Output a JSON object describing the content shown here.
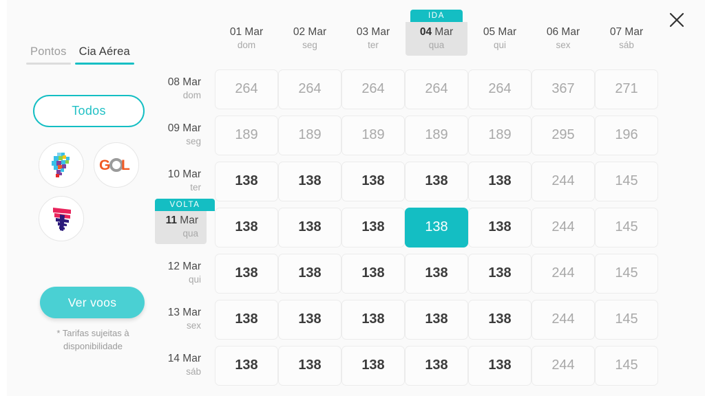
{
  "close_icon": "close-icon",
  "sidebar": {
    "tabs": [
      {
        "label": "Pontos",
        "active": false
      },
      {
        "label": "Cia Aérea",
        "active": true
      }
    ],
    "filter_button": "Todos",
    "airlines": [
      {
        "name": "azul-logo"
      },
      {
        "name": "gol-logo"
      },
      {
        "name": "latam-logo"
      }
    ],
    "cta_button": "Ver voos",
    "disclaimer": "* Tarifas sujeitas à disponibilidade"
  },
  "calendar": {
    "outbound_badge": "IDA",
    "return_badge": "VOLTA",
    "columns": [
      {
        "day": "01",
        "month": "Mar",
        "weekday": "dom",
        "selected": false
      },
      {
        "day": "02",
        "month": "Mar",
        "weekday": "seg",
        "selected": false
      },
      {
        "day": "03",
        "month": "Mar",
        "weekday": "ter",
        "selected": false
      },
      {
        "day": "04",
        "month": "Mar",
        "weekday": "qua",
        "selected": true
      },
      {
        "day": "05",
        "month": "Mar",
        "weekday": "qui",
        "selected": false
      },
      {
        "day": "06",
        "month": "Mar",
        "weekday": "sex",
        "selected": false
      },
      {
        "day": "07",
        "month": "Mar",
        "weekday": "sáb",
        "selected": false
      }
    ],
    "rows": [
      {
        "day": "08",
        "month": "Mar",
        "weekday": "dom",
        "selected": false
      },
      {
        "day": "09",
        "month": "Mar",
        "weekday": "seg",
        "selected": false
      },
      {
        "day": "10",
        "month": "Mar",
        "weekday": "ter",
        "selected": false
      },
      {
        "day": "11",
        "month": "Mar",
        "weekday": "qua",
        "selected": true
      },
      {
        "day": "12",
        "month": "Mar",
        "weekday": "qui",
        "selected": false
      },
      {
        "day": "13",
        "month": "Mar",
        "weekday": "sex",
        "selected": false
      },
      {
        "day": "14",
        "month": "Mar",
        "weekday": "sáb",
        "selected": false
      }
    ],
    "prices": [
      [
        {
          "value": "264",
          "style": "dim"
        },
        {
          "value": "264",
          "style": "dim"
        },
        {
          "value": "264",
          "style": "dim"
        },
        {
          "value": "264",
          "style": "dim"
        },
        {
          "value": "264",
          "style": "dim"
        },
        {
          "value": "367",
          "style": "dim"
        },
        {
          "value": "271",
          "style": "dim"
        }
      ],
      [
        {
          "value": "189",
          "style": "dim"
        },
        {
          "value": "189",
          "style": "dim"
        },
        {
          "value": "189",
          "style": "dim"
        },
        {
          "value": "189",
          "style": "dim"
        },
        {
          "value": "189",
          "style": "dim"
        },
        {
          "value": "295",
          "style": "dim"
        },
        {
          "value": "196",
          "style": "dim"
        }
      ],
      [
        {
          "value": "138",
          "style": "bold"
        },
        {
          "value": "138",
          "style": "bold"
        },
        {
          "value": "138",
          "style": "bold"
        },
        {
          "value": "138",
          "style": "bold"
        },
        {
          "value": "138",
          "style": "bold"
        },
        {
          "value": "244",
          "style": "dim"
        },
        {
          "value": "145",
          "style": "dim"
        }
      ],
      [
        {
          "value": "138",
          "style": "bold"
        },
        {
          "value": "138",
          "style": "bold"
        },
        {
          "value": "138",
          "style": "bold"
        },
        {
          "value": "138",
          "style": "sel"
        },
        {
          "value": "138",
          "style": "bold"
        },
        {
          "value": "244",
          "style": "dim"
        },
        {
          "value": "145",
          "style": "dim"
        }
      ],
      [
        {
          "value": "138",
          "style": "bold"
        },
        {
          "value": "138",
          "style": "bold"
        },
        {
          "value": "138",
          "style": "bold"
        },
        {
          "value": "138",
          "style": "bold"
        },
        {
          "value": "138",
          "style": "bold"
        },
        {
          "value": "244",
          "style": "dim"
        },
        {
          "value": "145",
          "style": "dim"
        }
      ],
      [
        {
          "value": "138",
          "style": "bold"
        },
        {
          "value": "138",
          "style": "bold"
        },
        {
          "value": "138",
          "style": "bold"
        },
        {
          "value": "138",
          "style": "bold"
        },
        {
          "value": "138",
          "style": "bold"
        },
        {
          "value": "244",
          "style": "dim"
        },
        {
          "value": "145",
          "style": "dim"
        }
      ],
      [
        {
          "value": "138",
          "style": "bold"
        },
        {
          "value": "138",
          "style": "bold"
        },
        {
          "value": "138",
          "style": "bold"
        },
        {
          "value": "138",
          "style": "bold"
        },
        {
          "value": "138",
          "style": "bold"
        },
        {
          "value": "244",
          "style": "dim"
        },
        {
          "value": "145",
          "style": "dim"
        }
      ]
    ]
  },
  "colors": {
    "teal": "#14bec3",
    "teal_light": "#4ad0d3",
    "selected_gray": "#e3e3e3",
    "background": "#fafafa"
  }
}
